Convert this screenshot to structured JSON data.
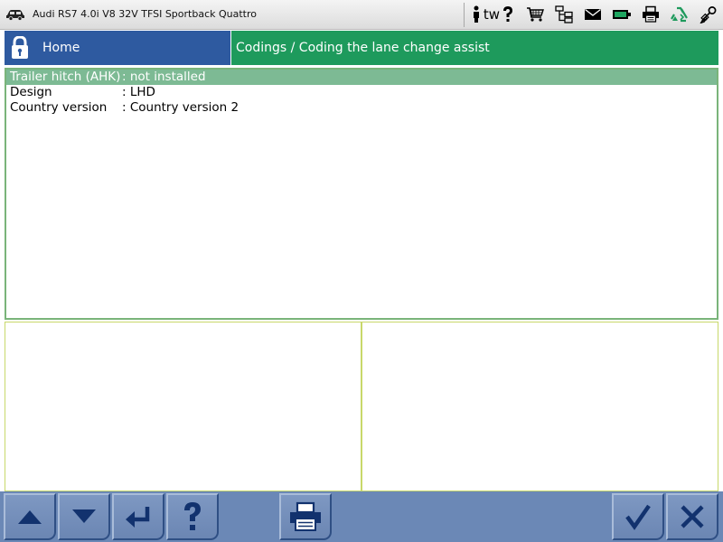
{
  "topbar": {
    "vehicle_title": "Audi RS7 4.0i V8 32V TFSI Sportback Quattro",
    "car_icon": "car-icon",
    "tw_label": "tw",
    "icons": [
      "info-person-icon",
      "help-icon",
      "cart-icon",
      "network-icon",
      "mail-icon",
      "battery-icon",
      "print-icon",
      "recycle-icon",
      "key-icon"
    ]
  },
  "header": {
    "home_label": "Home",
    "breadcrumb": "Codings / Coding the lane change assist"
  },
  "codings": [
    {
      "label": "Trailer hitch (AHK)",
      "value": ": not installed",
      "selected": true
    },
    {
      "label": "Design",
      "value": ": LHD",
      "selected": false
    },
    {
      "label": "Country version",
      "value": ": Country version 2",
      "selected": false
    }
  ],
  "toolbar": {
    "buttons": [
      "arrow-up-icon",
      "arrow-down-icon",
      "enter-icon",
      "help-icon",
      "print-icon",
      "checkmark-icon",
      "close-icon"
    ]
  },
  "colors": {
    "home_blue": "#2e5aa0",
    "breadcrumb_green": "#1e9a5c",
    "selected_row": "#7dba94",
    "toolbar_blue": "#6b88b6",
    "icon_navy": "#12326e"
  }
}
